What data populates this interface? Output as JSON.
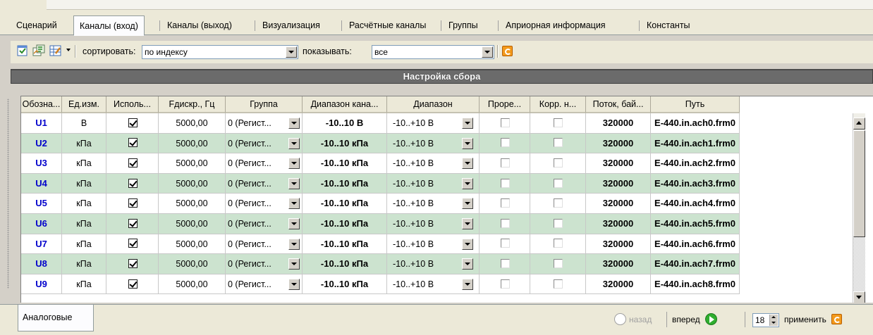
{
  "tabs": [
    {
      "label": "Сценарий"
    },
    {
      "label": "Каналы (вход)",
      "active": true
    },
    {
      "label": "Каналы (выход)"
    },
    {
      "label": "Визуализация"
    },
    {
      "label": "Расчётные каналы"
    },
    {
      "label": "Группы"
    },
    {
      "label": "Априорная информация"
    },
    {
      "label": "Константы"
    }
  ],
  "toolbar": {
    "sort_label": "сортировать:",
    "sort_value": "по индексу",
    "show_label": "показывать:",
    "show_value": "все"
  },
  "banner": "Настройка сбора",
  "columns": [
    "Обозна...",
    "Ед.изм.",
    "Исполь...",
    "Fдискр., Гц",
    "Группа",
    "Диапазон кана...",
    "Диапазон",
    "Проре...",
    "Корр. н...",
    "Поток, бай...",
    "Путь"
  ],
  "rows": [
    {
      "name": "U1",
      "unit": "В",
      "used": true,
      "freq": "5000,00",
      "group": "0 (Регист...",
      "range": "-10..10 В",
      "diap": "-10..+10 В",
      "thin": false,
      "corr": false,
      "stream": "320000",
      "path": "E-440.in.ach0.frm0"
    },
    {
      "name": "U2",
      "unit": "кПа",
      "used": true,
      "freq": "5000,00",
      "group": "0 (Регист...",
      "range": "-10..10 кПа",
      "diap": "-10..+10 В",
      "thin": false,
      "corr": false,
      "stream": "320000",
      "path": "E-440.in.ach1.frm0"
    },
    {
      "name": "U3",
      "unit": "кПа",
      "used": true,
      "freq": "5000,00",
      "group": "0 (Регист...",
      "range": "-10..10 кПа",
      "diap": "-10..+10 В",
      "thin": false,
      "corr": false,
      "stream": "320000",
      "path": "E-440.in.ach2.frm0"
    },
    {
      "name": "U4",
      "unit": "кПа",
      "used": true,
      "freq": "5000,00",
      "group": "0 (Регист...",
      "range": "-10..10 кПа",
      "diap": "-10..+10 В",
      "thin": false,
      "corr": false,
      "stream": "320000",
      "path": "E-440.in.ach3.frm0"
    },
    {
      "name": "U5",
      "unit": "кПа",
      "used": true,
      "freq": "5000,00",
      "group": "0 (Регист...",
      "range": "-10..10 кПа",
      "diap": "-10..+10 В",
      "thin": false,
      "corr": false,
      "stream": "320000",
      "path": "E-440.in.ach4.frm0"
    },
    {
      "name": "U6",
      "unit": "кПа",
      "used": true,
      "freq": "5000,00",
      "group": "0 (Регист...",
      "range": "-10..10 кПа",
      "diap": "-10..+10 В",
      "thin": false,
      "corr": false,
      "stream": "320000",
      "path": "E-440.in.ach5.frm0"
    },
    {
      "name": "U7",
      "unit": "кПа",
      "used": true,
      "freq": "5000,00",
      "group": "0 (Регист...",
      "range": "-10..10 кПа",
      "diap": "-10..+10 В",
      "thin": false,
      "corr": false,
      "stream": "320000",
      "path": "E-440.in.ach6.frm0"
    },
    {
      "name": "U8",
      "unit": "кПа",
      "used": true,
      "freq": "5000,00",
      "group": "0 (Регист...",
      "range": "-10..10 кПа",
      "diap": "-10..+10 В",
      "thin": false,
      "corr": false,
      "stream": "320000",
      "path": "E-440.in.ach7.frm0"
    },
    {
      "name": "U9",
      "unit": "кПа",
      "used": true,
      "freq": "5000,00",
      "group": "0 (Регист...",
      "range": "-10..10 кПа",
      "diap": "-10..+10 В",
      "thin": false,
      "corr": false,
      "stream": "320000",
      "path": "E-440.in.ach8.frm0"
    }
  ],
  "bottom": {
    "tab_label": "Аналоговые",
    "back_label": "назад",
    "forward_label": "вперед",
    "count_value": "18",
    "apply_label": "применить"
  },
  "colors": {
    "alt_row": "#cce3cf",
    "name_text": "#0000cc",
    "banner": "#6b6b6b"
  },
  "icons": [
    "filter-icon",
    "export-icon",
    "edit-columns-icon",
    "refresh-icon",
    "forward-arrow-icon"
  ]
}
